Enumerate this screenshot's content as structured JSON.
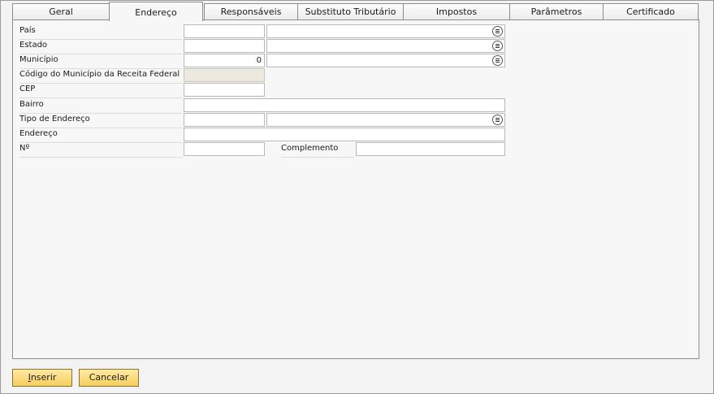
{
  "tabs": [
    {
      "label": "Geral"
    },
    {
      "label": "Endereço"
    },
    {
      "label": "Responsáveis"
    },
    {
      "label": "Substituto Tributário"
    },
    {
      "label": "Impostos"
    },
    {
      "label": "Parâmetros"
    },
    {
      "label": "Certificado"
    }
  ],
  "form": {
    "pais": {
      "label": "País",
      "code": "",
      "name": ""
    },
    "estado": {
      "label": "Estado",
      "code": "",
      "name": ""
    },
    "municipio": {
      "label": "Município",
      "code": "0",
      "name": ""
    },
    "codigo_receita": {
      "label": "Código do Município da Receita Federal",
      "value": ""
    },
    "cep": {
      "label": "CEP",
      "value": ""
    },
    "bairro": {
      "label": "Bairro",
      "value": ""
    },
    "tipo_endereco": {
      "label": "Tipo de Endereço",
      "code": "",
      "name": ""
    },
    "endereco": {
      "label": "Endereço",
      "value": ""
    },
    "numero": {
      "label": "Nº",
      "value": ""
    },
    "complemento": {
      "label": "Complemento",
      "value": ""
    }
  },
  "buttons": {
    "insert": "Inserir",
    "cancel": "Cancelar"
  },
  "icons": {
    "combo": "list-circle-icon"
  }
}
